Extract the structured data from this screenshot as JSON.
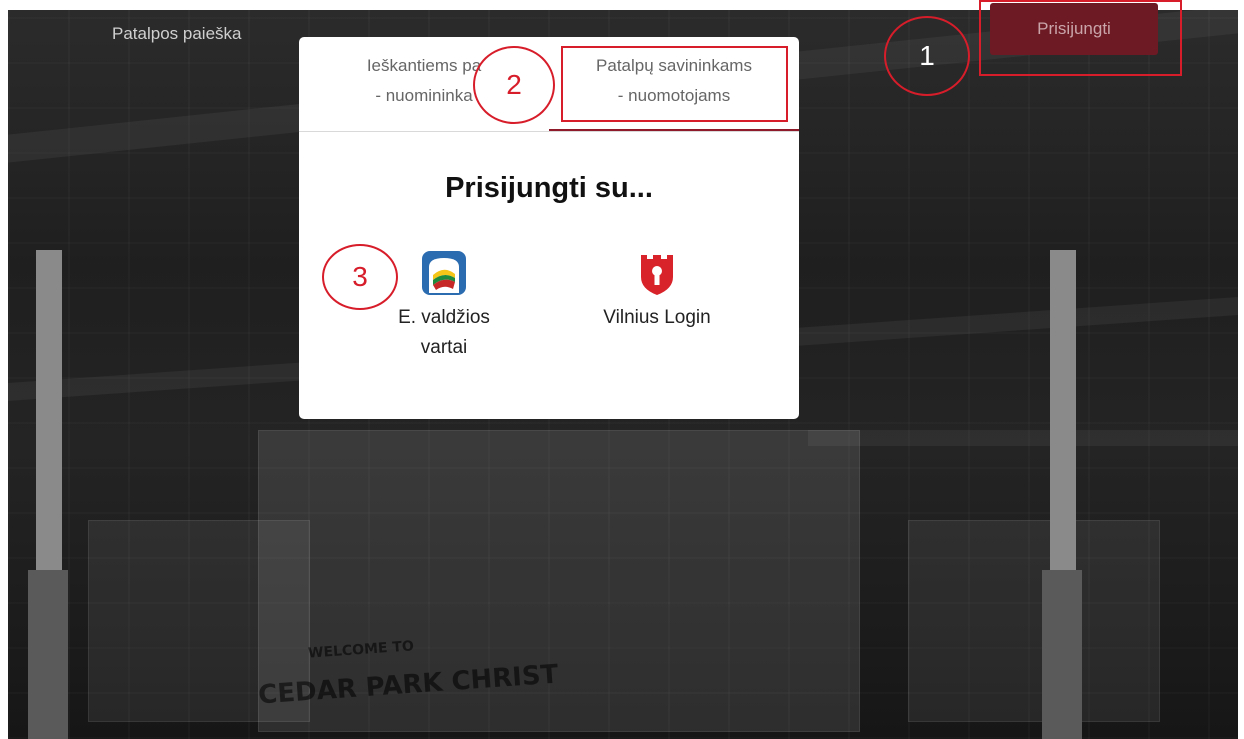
{
  "nav": {
    "search_link": "Patalpos paieška"
  },
  "header": {
    "login_button": "Prisijungti"
  },
  "modal": {
    "tabs": [
      {
        "label_line1": "Ieškantiems pa",
        "label_line2": "- nuomininka"
      },
      {
        "label_line1": "Patalpų savininkams",
        "label_line2": "- nuomotojams"
      }
    ],
    "title": "Prisijungti su...",
    "providers": [
      {
        "label_line1": "E. valdžios",
        "label_line2": "vartai",
        "icon": "evaldzios-vartai-icon"
      },
      {
        "label_line1": "Vilnius Login",
        "icon": "vilnius-login-shield-icon"
      }
    ]
  },
  "annotations": [
    "1",
    "2",
    "3"
  ],
  "background": {
    "sign_line1": "WELCOME TO",
    "sign_line2": "CEDAR PARK CHRIST"
  },
  "colors": {
    "accent": "#d71d2a",
    "login_button": "#6e1a24",
    "tab_active": "#8f1b2a",
    "vilnius_red": "#d8232a",
    "evaldzios_blue": "#2b6cb0"
  }
}
